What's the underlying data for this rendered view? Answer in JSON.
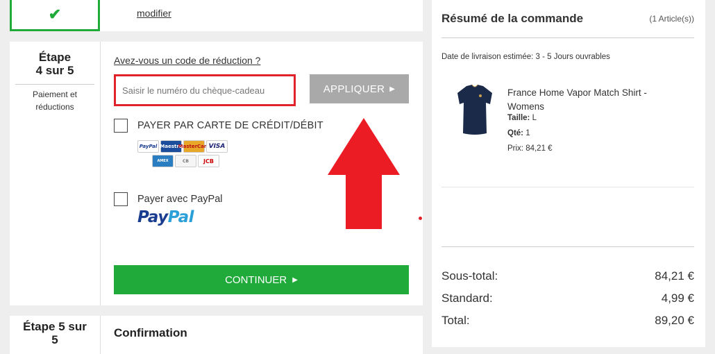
{
  "step3": {
    "check_glyph": "✔",
    "modify_link": "modifier"
  },
  "step4": {
    "title_line1": "Étape",
    "title_line2": "4 sur 5",
    "subtitle_line1": "Paiement et",
    "subtitle_line2": "réductions",
    "promo_link": "Avez-vous un code de réduction ?",
    "gift_input": {
      "placeholder": "Saisir le numéro du chèque-cadeau",
      "value": ""
    },
    "apply_label": "APPLIQUER",
    "apply_arrow": "▶",
    "card_option_label": "PAYER PAR CARTE DE CRÉDIT/DÉBIT",
    "card_logos": {
      "row1": [
        "PayPal",
        "Maestro",
        "MasterCard",
        "VISA"
      ],
      "row2": [
        "AMEX",
        "CB",
        "JCB"
      ]
    },
    "paypal_option_label": "Payer avec PayPal",
    "paypal_logo": {
      "part1": "Pay",
      "part2": "Pal"
    },
    "continue_label": "CONTINUER",
    "continue_arrow": "▶"
  },
  "step5": {
    "title_line1": "Étape 5 sur",
    "title_line2": "5",
    "confirm_title": "Confirmation"
  },
  "summary": {
    "title": "Résumé de la commande",
    "count": "(1 Article(s))",
    "delivery": "Date de livraison estimée: 3 - 5 Jours ouvrables",
    "product": {
      "name": "France Home Vapor Match Shirt - Womens",
      "size_label": "Taille:",
      "size_value": "L",
      "qty_label": "Qté:",
      "qty_value": "1",
      "price": "Prix: 84,21 €",
      "image_icon": "navy-shirt-image"
    },
    "totals": [
      {
        "label": "Sous-total:",
        "value": "84,21 €"
      },
      {
        "label": "Standard:",
        "value": "4,99 €"
      },
      {
        "label": "Total:",
        "value": "89,20 €"
      }
    ]
  },
  "annotation": {
    "arrow_icon": "red-up-arrow-icon",
    "arrow_color": "#ec1c24"
  },
  "colors": {
    "green": "#1faa3a",
    "red": "#e0232a",
    "apply_gray": "#a9a9a9",
    "navy": "#1c2a4a"
  }
}
